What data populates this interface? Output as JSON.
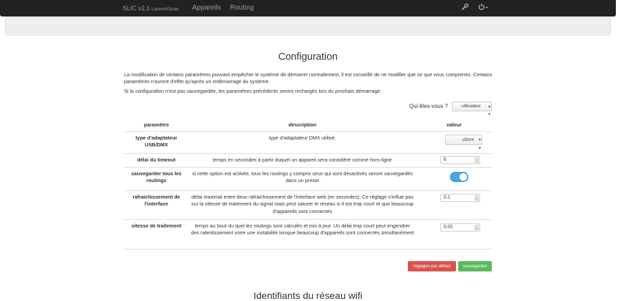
{
  "navbar": {
    "brand": "SLIC v2.1",
    "brand_user": "LaurentOutan",
    "links": [
      "Appareils",
      "Routing"
    ],
    "settings_icon": "wrench-icon",
    "power_icon": "power-icon"
  },
  "config": {
    "title": "Configuration",
    "intro_line1": "La modification de certains paramètres pouvant empêcher le système de démarrer normalement, il est conseillé de ne modifier que ce que vous comprenez. Certains paramètres n'auront d'effet qu'après un redémarrage du système.",
    "intro_line2": "Si la configuration n'est pas sauvegardée, les paramètres précédents seront rechargés lors du prochain démarrage.",
    "who_label": "Qui êtes-vous ?",
    "who_value": "utilisateur",
    "headers": {
      "param": "paramètre",
      "desc": "description",
      "value": "valeur"
    },
    "rows": [
      {
        "param": "type d'adaptateur USB/DMX",
        "desc": "type d'adaptateur DMX utilisé.",
        "value": "uDmx",
        "kind": "select"
      },
      {
        "param": "délai du timeout",
        "desc": "temps en secondes à partir duquel un appareil sera considéré comme hors-ligne",
        "value": "6",
        "kind": "number"
      },
      {
        "param": "sauvegarder tous les routings",
        "desc": "si cette option est activée, tous les routings y compris ceux qui sont désactivés seront sauvegardés dans un preset",
        "value": true,
        "kind": "toggle"
      },
      {
        "param": "rafraichissement de l'interface",
        "desc": "délai maximal entre deux rafraichissement de l'interface web (en secondes). Ce réglage n'influe pas sur la vitesse de traitement du signal mais peut saturer le réseau si il est trop court et que beaucoup d'appareils sont connectés",
        "value": "0.1",
        "kind": "number"
      },
      {
        "param": "vitesse de traitement",
        "desc": "temps au bout du quel les routings sont calculés et mis à jour. Un délai trop court peut engendrer des ralentissement voire une instabilité lorsque beaucoup d'appareils sont connectés simultanément",
        "value": "0.01",
        "kind": "number"
      }
    ],
    "btn_default": "réglages par défaut",
    "btn_save": "sauvegarder"
  },
  "wifi": {
    "title": "Identifiants du réseau wifi"
  },
  "colors": {
    "navbar": "#222222",
    "danger": "#d9534f",
    "success": "#5cb85c",
    "toggle_on": "#4aa4dd"
  }
}
